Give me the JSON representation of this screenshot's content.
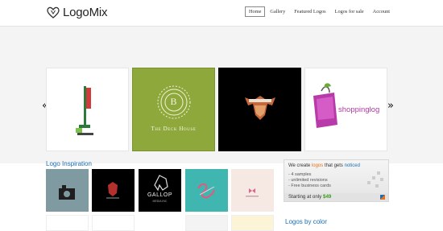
{
  "brand": {
    "name": "LogoMix"
  },
  "nav": {
    "items": [
      "Home",
      "Gallery",
      "Featured Logos",
      "Logos for sale",
      "Account"
    ]
  },
  "carousel": {
    "prev": "«",
    "next": "»",
    "slides": [
      {
        "text": ""
      },
      {
        "letter": "B",
        "text": "The Deck House"
      },
      {
        "text": ""
      },
      {
        "text": "shoppinglog"
      }
    ]
  },
  "inspiration": {
    "title": "Logo Inspiration",
    "thumbs": [
      {
        "text": ""
      },
      {
        "text": ""
      },
      {
        "text": "GALLOP",
        "subtext": "MEDIA INC"
      },
      {
        "text": ""
      },
      {
        "text": ""
      }
    ]
  },
  "promo": {
    "line_prefix": "We create ",
    "line_word1": "logos",
    "line_mid": " that gets ",
    "line_word2": "noticed",
    "features": [
      "- 4 samples",
      "- unlimited revisions",
      "- Free business cards"
    ],
    "price_prefix": "Starting at only ",
    "price": "$49"
  },
  "by_color": {
    "title": "Logos by color"
  },
  "colors": {
    "accent_blue": "#1a6fb4",
    "accent_orange": "#e8731a",
    "price_green": "#3a9d1e"
  }
}
